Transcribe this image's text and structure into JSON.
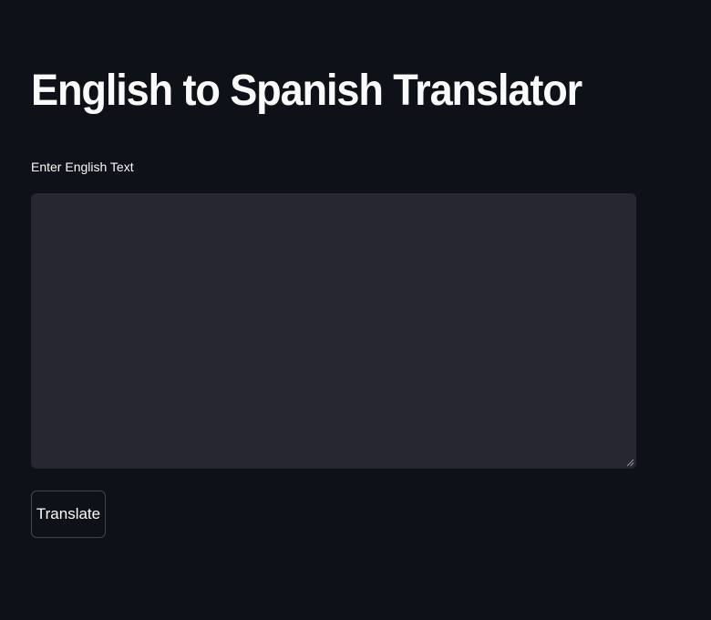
{
  "page": {
    "title": "English to Spanish Translator"
  },
  "input": {
    "label": "Enter English Text",
    "value": "",
    "placeholder": ""
  },
  "actions": {
    "translate_label": "Translate"
  },
  "colors": {
    "background": "#0e1117",
    "input_background": "#262730",
    "text": "#fafafa",
    "button_border": "#3a3c44"
  }
}
